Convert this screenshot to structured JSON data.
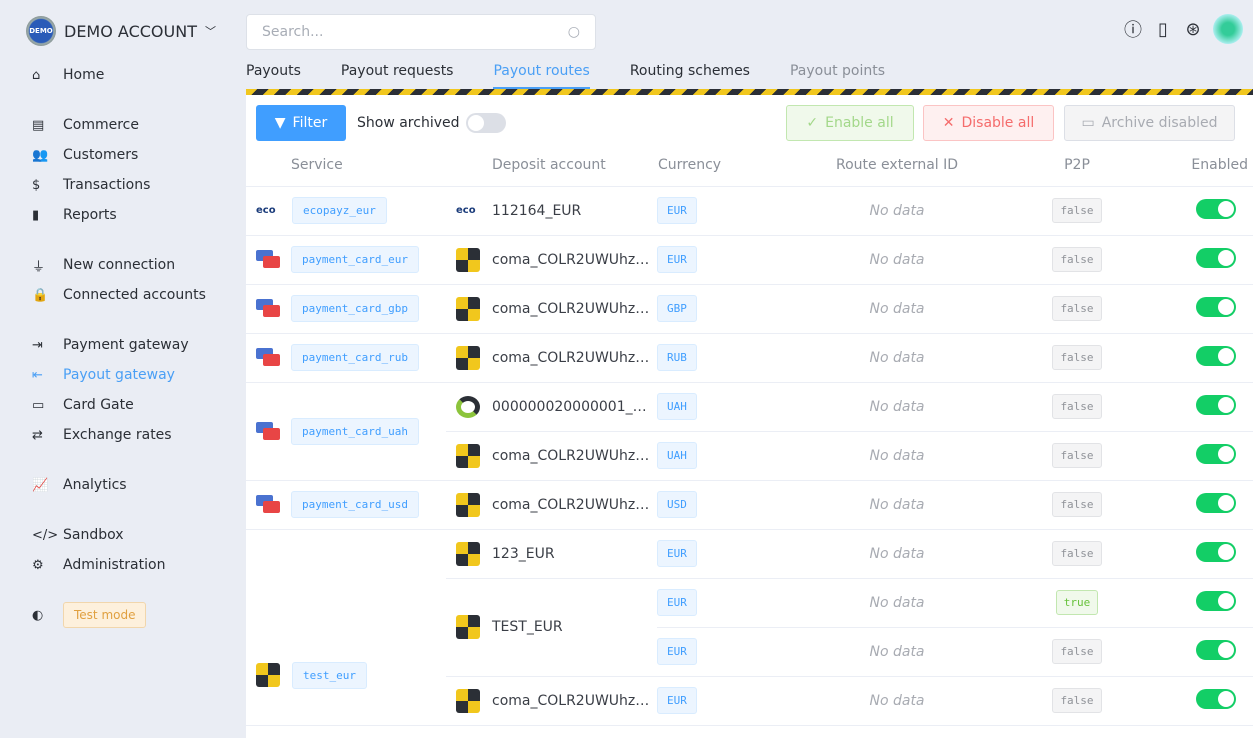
{
  "account": {
    "logo_text": "DEMO",
    "name": "DEMO ACCOUNT"
  },
  "sidebar": {
    "items": [
      {
        "label": "Home",
        "icon": "home-icon",
        "glyph": "⌂"
      },
      {
        "label": "Commerce",
        "icon": "store-icon",
        "glyph": "▤"
      },
      {
        "label": "Customers",
        "icon": "users-icon",
        "glyph": "👥"
      },
      {
        "label": "Transactions",
        "icon": "dollar-icon",
        "glyph": "$"
      },
      {
        "label": "Reports",
        "icon": "file-icon",
        "glyph": "▮"
      },
      {
        "label": "New connection",
        "icon": "plug-icon",
        "glyph": "⏚"
      },
      {
        "label": "Connected accounts",
        "icon": "lock-icon",
        "glyph": "🔒"
      },
      {
        "label": "Payment gateway",
        "icon": "sign-in-icon",
        "glyph": "⇥"
      },
      {
        "label": "Payout gateway",
        "icon": "sign-out-icon",
        "glyph": "⇤"
      },
      {
        "label": "Card Gate",
        "icon": "card-icon",
        "glyph": "▭"
      },
      {
        "label": "Exchange rates",
        "icon": "exchange-icon",
        "glyph": "⇄"
      },
      {
        "label": "Analytics",
        "icon": "chart-icon",
        "glyph": "📈"
      },
      {
        "label": "Sandbox",
        "icon": "code-icon",
        "glyph": "</>"
      },
      {
        "label": "Administration",
        "icon": "gear-icon",
        "glyph": "⚙"
      }
    ],
    "test_mode": "Test mode"
  },
  "search": {
    "placeholder": "Search..."
  },
  "tabs": [
    "Payouts",
    "Payout requests",
    "Payout routes",
    "Routing schemes",
    "Payout points"
  ],
  "toolbar": {
    "filter": "Filter",
    "show_archived": "Show archived",
    "enable_all": "Enable all",
    "disable_all": "Disable all",
    "archive_disabled": "Archive disabled"
  },
  "columns": [
    "Service",
    "Deposit account",
    "Currency",
    "Route external ID",
    "P2P",
    "Enabled"
  ],
  "services": [
    "ecopayz_eur",
    "payment_card_eur",
    "payment_card_gbp",
    "payment_card_rub",
    "payment_card_uah",
    "payment_card_usd",
    "test_eur"
  ],
  "eco_logo": "eco",
  "accounts": [
    "112164_EUR",
    "coma_COLR2UWUhz…",
    "000000020000001_…",
    "123_EUR",
    "TEST_EUR"
  ],
  "currencies": [
    "EUR",
    "GBP",
    "RUB",
    "UAH",
    "USD"
  ],
  "no_data": "No data",
  "p2p": {
    "false": "false",
    "true": "true"
  }
}
